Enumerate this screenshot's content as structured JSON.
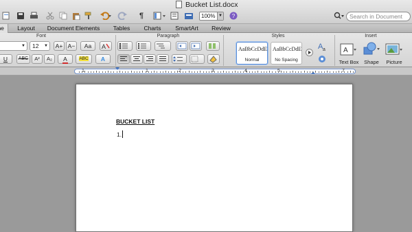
{
  "window": {
    "title": "Bucket List.docx"
  },
  "toolbar": {
    "zoom": "100%",
    "search_placeholder": "Search in Document",
    "paragraph_mark": "¶"
  },
  "tabs": [
    "me",
    "Layout",
    "Document Elements",
    "Tables",
    "Charts",
    "SmartArt",
    "Review"
  ],
  "ribbon": {
    "groups": {
      "font": "Font",
      "paragraph": "Paragraph",
      "styles": "Styles",
      "insert": "Insert"
    },
    "font_size": "12",
    "font_buttons": {
      "grow": "A+",
      "shrink": "A−",
      "case": "Aa",
      "underline": "U",
      "strike": "ABC",
      "superscript": "A²",
      "subscript": "A₂",
      "color": "A",
      "highlight": "ABC",
      "effects": "A"
    },
    "styles": [
      {
        "preview": "AaBbCcDdEe",
        "label": "Normal"
      },
      {
        "preview": "AaBbCcDdEe",
        "label": "No Spacing"
      }
    ],
    "insert": {
      "textbox": "Text Box",
      "shape": "Shape",
      "picture": "Picture"
    }
  },
  "ruler": {
    "labels": [
      "1",
      "1",
      "2",
      "3",
      "4",
      "5",
      "7"
    ]
  },
  "document": {
    "heading": "BUCKET LIST",
    "list_item": "1."
  },
  "colors": {
    "accent": "#5b8ed6",
    "font_color": "#d12a2a",
    "highlight": "#f3e03b"
  }
}
